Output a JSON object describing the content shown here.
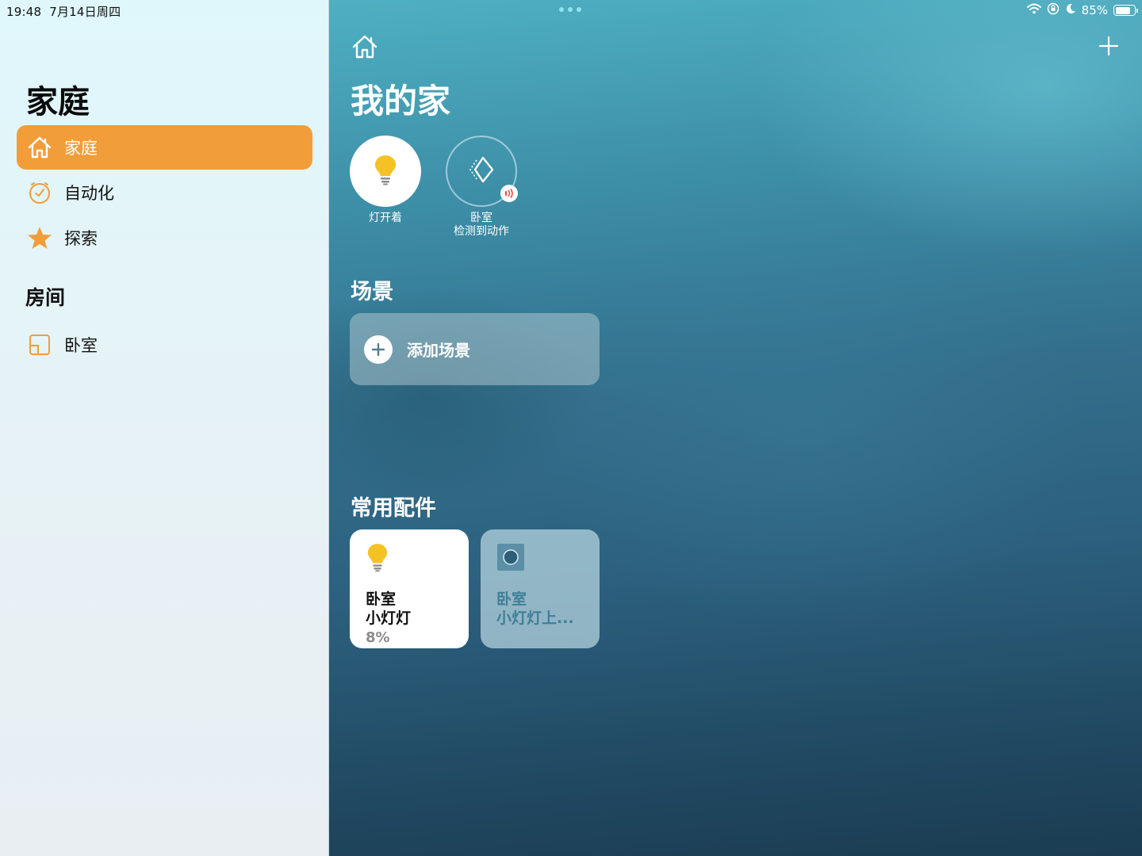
{
  "status_bar": {
    "time": "19:48",
    "date": "7月14日周四",
    "battery_percent_label": "85%",
    "battery_level": 0.85
  },
  "sidebar": {
    "title": "家庭",
    "items": [
      {
        "label": "家庭",
        "icon": "house-icon",
        "active": true
      },
      {
        "label": "自动化",
        "icon": "clock-icon",
        "active": false
      },
      {
        "label": "探索",
        "icon": "star-icon",
        "active": false
      }
    ],
    "rooms_title": "房间",
    "rooms": [
      {
        "label": "卧室",
        "icon": "room-icon"
      }
    ]
  },
  "main": {
    "title": "我的家",
    "status_tiles": [
      {
        "label": "灯开着",
        "icon": "lightbulb-icon"
      },
      {
        "label_line1": "卧室",
        "label_line2": "检测到动作",
        "icon": "motion-sensor-icon"
      }
    ],
    "scenes_title": "场景",
    "add_scene_label": "添加场景",
    "accessories_title": "常用配件",
    "accessories": [
      {
        "room": "卧室",
        "name": "小灯灯",
        "status": "8%",
        "on": true,
        "icon": "lightbulb-icon"
      },
      {
        "room": "卧室",
        "name": "小灯灯上...",
        "status": "",
        "on": false,
        "icon": "switch-icon"
      }
    ]
  },
  "colors": {
    "accent": "#f19d39",
    "bulb": "#f5c225",
    "motion_red": "#e8493f"
  }
}
